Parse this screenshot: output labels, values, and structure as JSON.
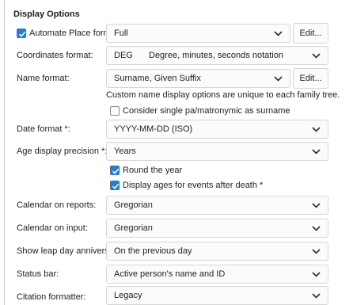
{
  "section": {
    "title": "Display Options"
  },
  "automate_place": {
    "checkbox_label": "Automate Place format:",
    "checked": true,
    "value": "Full",
    "edit_label": "Edit..."
  },
  "coordinates": {
    "label": "Coordinates format:",
    "code": "DEG",
    "description": "Degree, minutes, seconds notation"
  },
  "name_format": {
    "label": "Name format:",
    "value": "Surname, Given Suffix",
    "edit_label": "Edit...",
    "note": "Custom name display options are unique to each family tree.",
    "patronymic_label": "Consider single pa/matronymic as surname",
    "patronymic_checked": false
  },
  "date_format": {
    "label": "Date format *:",
    "value": "YYYY-MM-DD (ISO)"
  },
  "age_precision": {
    "label": "Age display precision *:",
    "value": "Years",
    "round_label": "Round the year",
    "round_checked": true,
    "after_death_label": "Display ages for events after death *",
    "after_death_checked": true
  },
  "calendar_reports": {
    "label": "Calendar on reports:",
    "value": "Gregorian"
  },
  "calendar_input": {
    "label": "Calendar on input:",
    "value": "Gregorian"
  },
  "leap_day": {
    "label": "Show leap day anniversaries:",
    "value": "On the previous day"
  },
  "status_bar": {
    "label": "Status bar:",
    "value": "Active person's name and ID"
  },
  "citation": {
    "label": "Citation formatter:",
    "value": "Legacy"
  },
  "icons": {
    "dropdown": "chevron-down-icon",
    "check": "checkmark-icon"
  },
  "colors": {
    "accent": "#2a7ad1",
    "border": "#d6d6d6",
    "background": "#ffffff"
  }
}
